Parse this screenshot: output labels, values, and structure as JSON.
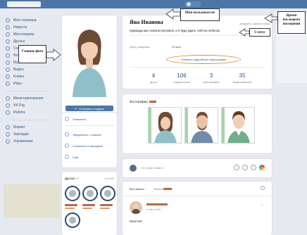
{
  "menu": {
    "items": [
      {
        "label": "Моя страница",
        "icon": "home-icon"
      },
      {
        "label": "Новости",
        "icon": "news-icon"
      },
      {
        "label": "Мессенджер",
        "icon": "message-icon"
      },
      {
        "label": "Друзья",
        "icon": "friends-icon"
      },
      {
        "label": "Сообщества",
        "icon": "groups-icon"
      },
      {
        "label": "Фотографии",
        "icon": "photo-icon"
      },
      {
        "label": "Музыка",
        "icon": "music-icon"
      },
      {
        "label": "Видео",
        "icon": "video-icon"
      },
      {
        "label": "Клипы",
        "icon": "clips-icon"
      },
      {
        "label": "Игры",
        "icon": "games-icon"
      }
    ],
    "items2": [
      {
        "label": "Мини-приложения",
        "icon": "apps-icon"
      },
      {
        "label": "VK Pay",
        "icon": "pay-icon"
      },
      {
        "label": "Работа",
        "icon": "work-icon"
      }
    ],
    "items3": [
      {
        "label": "Маркет",
        "icon": "market-icon"
      },
      {
        "label": "Закладки",
        "icon": "bookmark-icon"
      },
      {
        "label": "Управление",
        "icon": "manage-icon"
      }
    ]
  },
  "profile": {
    "name": "Яна Иванова",
    "status": "Однажды мы снова встретимся, и я буду ждать тебя на небесах",
    "last_seen": "заходила 2 минуты назад",
    "birthday_label": "День рождения:",
    "birthday_value": "23 мая",
    "show_more": "Показать подробную информацию",
    "stats": [
      {
        "num": "4",
        "label": "друга"
      },
      {
        "num": "106",
        "label": "подписчиков"
      },
      {
        "num": "3",
        "label": "фотографии"
      },
      {
        "num": "35",
        "label": "видеозаписей"
      }
    ]
  },
  "avatar_card": {
    "gift_button": "Отправить подарок",
    "subscribe_button": "Подписаться"
  },
  "actions": {
    "call": "Позвонить",
    "notify": "Уведомлять о записях",
    "bookmark": "Сохранить в закладках",
    "more": "Ещё"
  },
  "friends": {
    "title": "Друзья",
    "count": "4",
    "all": "онлайн"
  },
  "photos": {
    "title": "Фотографии"
  },
  "newpost": {
    "placeholder": "Что у вас нового?"
  },
  "wall": {
    "tab_all": "Все записи",
    "tab_user": "Записи",
    "post_time": "2 янв в 0:00",
    "post_text": "Прости",
    "post_heart": "♥"
  },
  "annotations": {
    "photo": "Главное фото",
    "name": "Имя пользователя",
    "time": "Время последнего посещения",
    "status": "Статус"
  },
  "colors": {
    "topbar": "#4a76a8",
    "link": "#2a5885",
    "highlight_oval": "#e38b2b"
  }
}
